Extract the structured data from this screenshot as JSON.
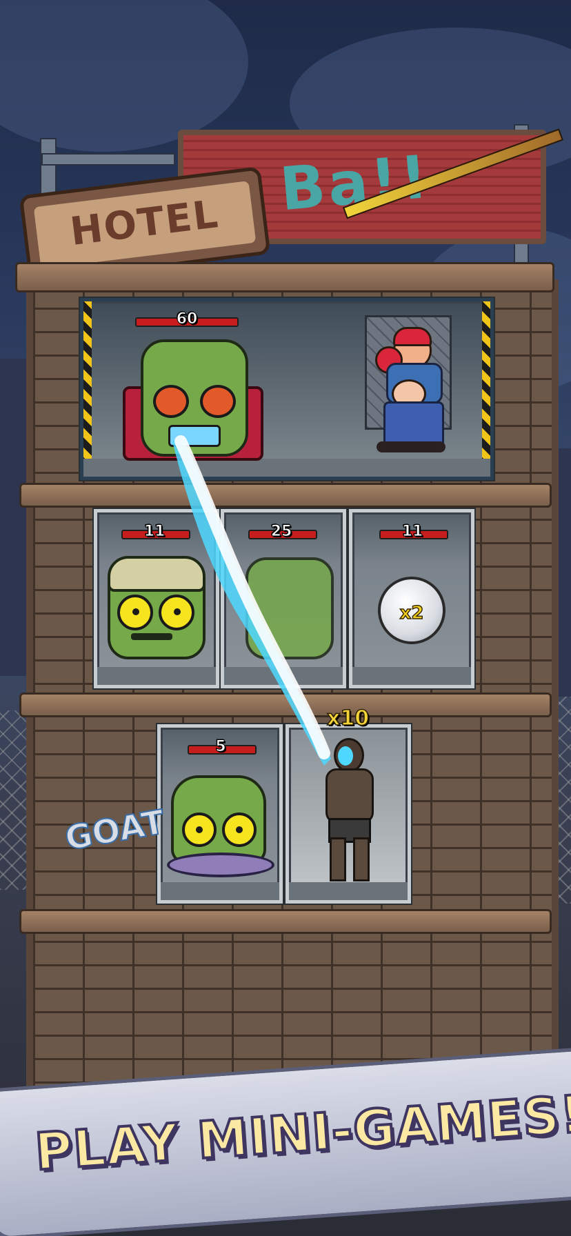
{
  "game": {
    "hotel_sign": "HOTEL",
    "roof_sign": "Ba!!",
    "graffiti": "GOAT",
    "banner_text": "PLAY MINI-GAMES!"
  },
  "rooms": {
    "top": {
      "enemy_hp": "60"
    },
    "middle": [
      {
        "hp": "11",
        "content": "bandaged-zombie"
      },
      {
        "hp": "25",
        "content": "zombie-head"
      },
      {
        "hp": "11",
        "content": "x2-bonus",
        "bonus": "x2"
      }
    ],
    "bottom": [
      {
        "hp": "5",
        "content": "helmet-zombie"
      },
      {
        "multiplier": "x10",
        "content": "hero-runner"
      }
    ]
  },
  "colors": {
    "hp_bar": "#c81d1d",
    "banner_text": "#fbe9a3",
    "laser": "#4fd8ff",
    "zombie_skin": "#76a94a"
  }
}
